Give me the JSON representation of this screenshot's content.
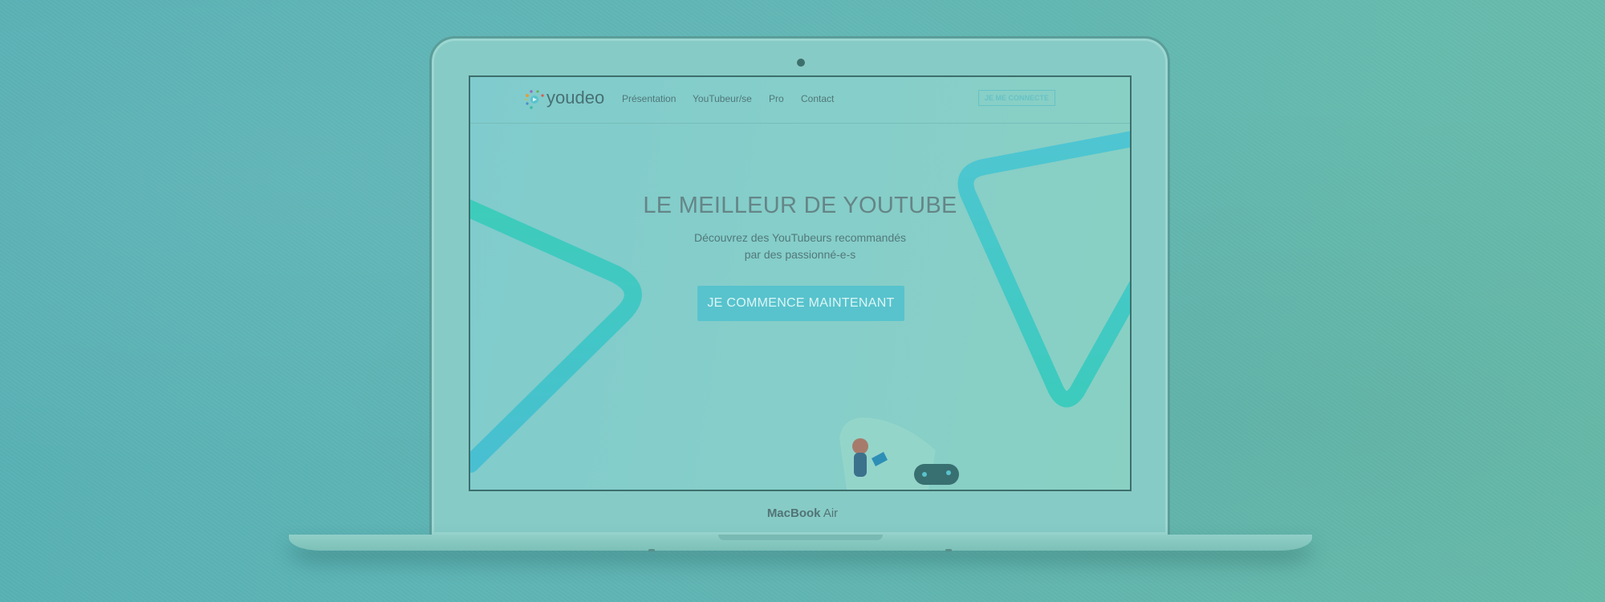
{
  "laptop": {
    "brand_bold": "MacBook",
    "brand_light": "Air"
  },
  "site": {
    "logo_text": "youdeo",
    "nav": [
      "Présentation",
      "YouTubeur/se",
      "Pro",
      "Contact"
    ],
    "login_label": "JE ME CONNECTE",
    "hero": {
      "title": "LE MEILLEUR DE YOUTUBE",
      "subtitle_line1": "Découvrez des YouTubeurs recommandés",
      "subtitle_line2": "par des passionné-e-s",
      "cta_label": "JE COMMENCE MAINTENANT"
    }
  },
  "colors": {
    "background": "#62b6b6",
    "screen": "#8bd1cd",
    "accent": "#5cc6d1",
    "title": "#6a8486"
  }
}
